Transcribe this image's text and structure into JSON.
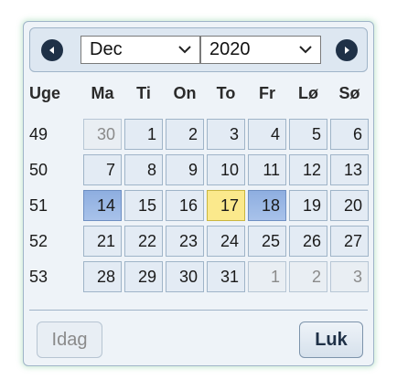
{
  "header": {
    "prev_icon": "chevron-left-icon",
    "next_icon": "chevron-right-icon",
    "month_selected": "Dec",
    "year_selected": "2020"
  },
  "weekdays": {
    "week": "Uge",
    "d0": "Ma",
    "d1": "Ti",
    "d2": "On",
    "d3": "To",
    "d4": "Fr",
    "d5": "Lø",
    "d6": "Sø"
  },
  "weeks": [
    {
      "week": "49",
      "days": [
        "30",
        "1",
        "2",
        "3",
        "4",
        "5",
        "6"
      ]
    },
    {
      "week": "50",
      "days": [
        "7",
        "8",
        "9",
        "10",
        "11",
        "12",
        "13"
      ]
    },
    {
      "week": "51",
      "days": [
        "14",
        "15",
        "16",
        "17",
        "18",
        "19",
        "20"
      ]
    },
    {
      "week": "52",
      "days": [
        "21",
        "22",
        "23",
        "24",
        "25",
        "26",
        "27"
      ]
    },
    {
      "week": "53",
      "days": [
        "28",
        "29",
        "30",
        "31",
        "1",
        "2",
        "3"
      ]
    }
  ],
  "today_label": "Idag",
  "close_label": "Luk",
  "colors": {
    "today_highlight": "#fbe98c",
    "selected_highlight": "#8eaee0",
    "nav_button": "#1f3147",
    "border": "#9fb4c8"
  }
}
